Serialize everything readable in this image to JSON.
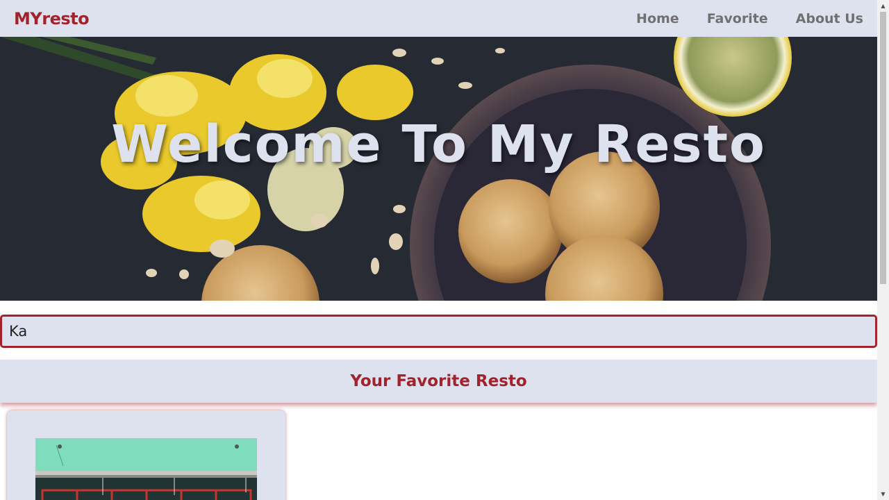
{
  "nav": {
    "brand": "MYresto",
    "links": [
      "Home",
      "Favorite",
      "About Us"
    ]
  },
  "hero": {
    "title": "Welcome To My Resto"
  },
  "search": {
    "value": "Ka"
  },
  "section": {
    "title": "Your Favorite Resto"
  },
  "colors": {
    "accent": "#a3232d",
    "surface": "#dde2ee",
    "nav_text": "#707070"
  },
  "icons": {
    "scroll_up": "triangle-up-icon",
    "scroll_down": "triangle-down-icon"
  }
}
